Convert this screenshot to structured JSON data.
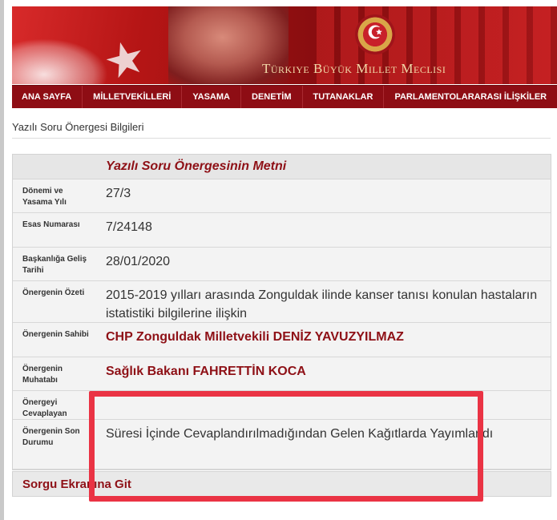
{
  "header": {
    "title": "Türkiye Büyük Millet Meclisi",
    "emblem_glyph": "☪"
  },
  "nav": {
    "items": [
      "ANA SAYFA",
      "MİLLETVEKİLLERİ",
      "YASAMA",
      "DENETİM",
      "TUTANAKLAR",
      "PARLAMENTOLARARASI İLİŞKİLER"
    ]
  },
  "page": {
    "breadcrumb": "Yazılı Soru Önergesi Bilgileri",
    "section_title": "Yazılı Soru Önergesinin Metni"
  },
  "details": {
    "rows": [
      {
        "label": "Dönemi ve Yasama Yılı",
        "value": "27/3",
        "emphasis": false
      },
      {
        "label": "Esas Numarası",
        "value": "7/24148",
        "emphasis": false
      },
      {
        "label": "Başkanlığa Geliş Tarihi",
        "value": "28/01/2020",
        "emphasis": false
      },
      {
        "label": "Önergenin Özeti",
        "value": "2015-2019 yılları arasında Zonguldak ilinde kanser tanısı konulan hastaların istatistiki bilgilerine ilişkin",
        "emphasis": false
      },
      {
        "label": "Önergenin Sahibi",
        "value": "CHP Zonguldak Milletvekili DENİZ YAVUZYILMAZ",
        "emphasis": true
      },
      {
        "label": "Önergenin Muhatabı",
        "value": "Sağlık Bakanı FAHRETTİN KOCA",
        "emphasis": true
      },
      {
        "label": "Önergeyi Cevaplayan",
        "value": "",
        "emphasis": false
      },
      {
        "label": "Önergenin Son Durumu",
        "value": "Süresi İçinde Cevaplandırılmadığından Gelen Kağıtlarda Yayımlandı",
        "emphasis": false
      }
    ]
  },
  "footer": {
    "link_label": "Sorgu Ekranına Git"
  },
  "colors": {
    "accent": "#8e1016",
    "nav_bg": "#8e0d14",
    "highlight": "#ea3344"
  }
}
